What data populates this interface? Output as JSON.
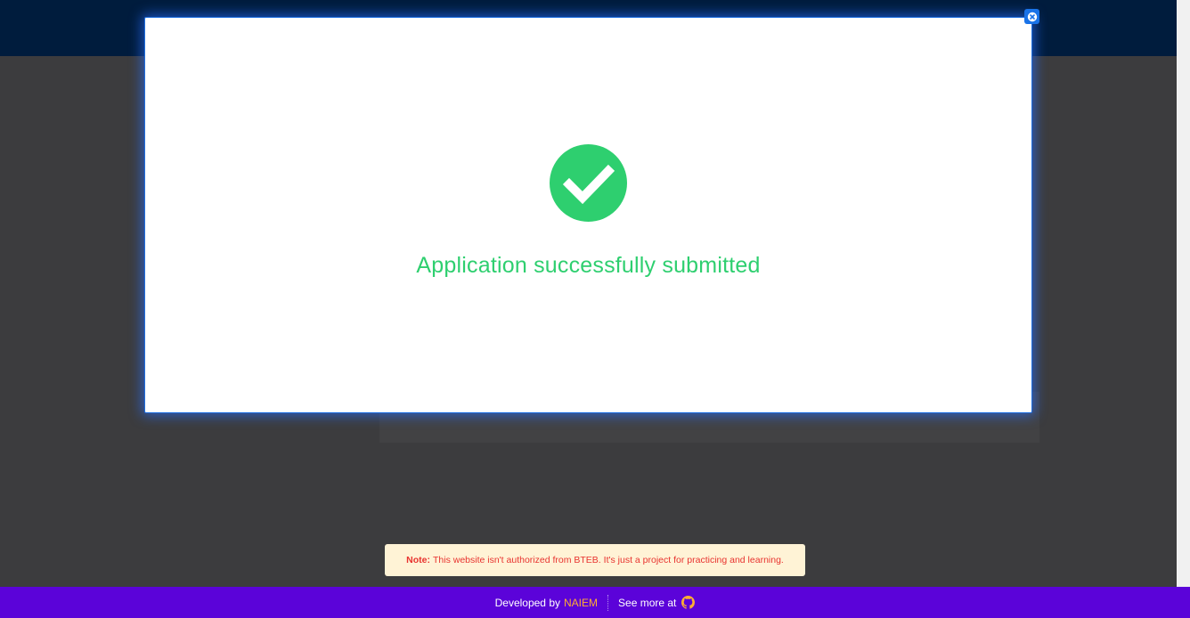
{
  "modal": {
    "message": "Application successfully submitted",
    "success_color": "#2ecf6f",
    "close_icon": "close-icon",
    "status_icon": "check-circle-icon"
  },
  "note": {
    "label": "Note:",
    "text": "This website isn't authorized from BTEB. It's just a project for practicing and learning."
  },
  "footer": {
    "developed_by": "Developed by",
    "developer_name": "NAIEM",
    "see_more": "See more at",
    "link_icon": "github-icon",
    "background": "#5b03d9",
    "accent": "#ffae33"
  },
  "header": {
    "background": "#001c3d"
  }
}
